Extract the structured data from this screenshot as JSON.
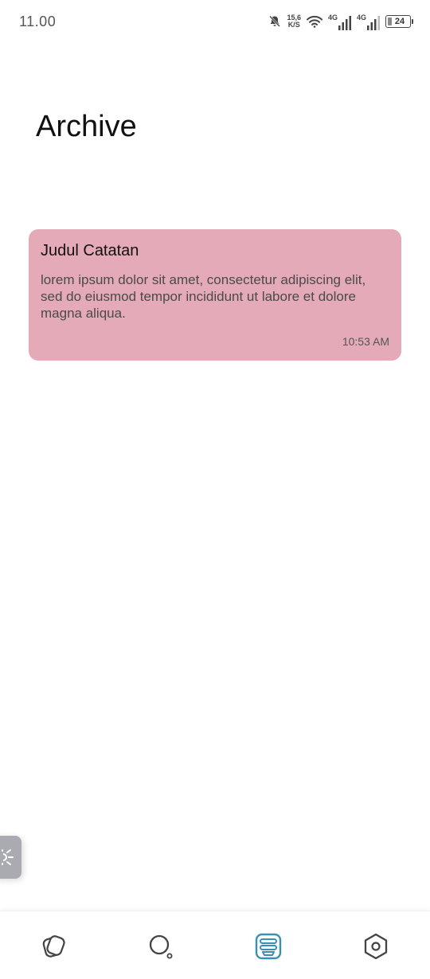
{
  "status_bar": {
    "time": "11.00",
    "speed_value": "15,6",
    "speed_unit": "K/S",
    "network1": "4G",
    "network2": "4G",
    "battery": "24"
  },
  "page": {
    "title": "Archive"
  },
  "notes": [
    {
      "title": "Judul Catatan",
      "body": "lorem ipsum dolor sit amet, consectetur adipiscing elit, sed do eiusmod tempor incididunt ut labore et dolore magna aliqua.",
      "time": "10:53 AM",
      "color": "#e5aab8"
    }
  ],
  "bottom_nav": {
    "items": [
      {
        "icon": "notes-icon",
        "active": false
      },
      {
        "icon": "search-icon",
        "active": false
      },
      {
        "icon": "archive-icon",
        "active": true
      },
      {
        "icon": "settings-icon",
        "active": false
      }
    ],
    "active_color": "#3a8fb5",
    "inactive_color": "#444444"
  },
  "side_button": {
    "icon": "theme-toggle-icon"
  }
}
